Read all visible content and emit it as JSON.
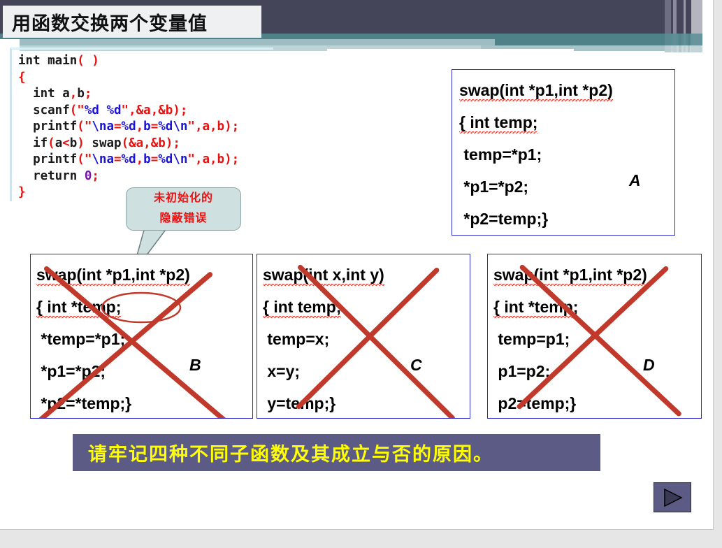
{
  "slide": {
    "title": "用函数交换两个变量值",
    "banner_text": "请牢记四种不同子函数及其成立与否的原因。",
    "next_label": "play-triangle"
  },
  "theme": {
    "band_dark": "#454559",
    "band_teal": "#4f8288",
    "band_light_blue": "#a8c3c8",
    "box_border": "#2a2ad0",
    "mark_red": "#c0392b",
    "banner_bg": "#5b5b86",
    "banner_fg": "#ffff00",
    "callout_bg": "#cfe0e0",
    "callout_fg": "#ee1111",
    "code_punct": "#e8110f",
    "code_blue": "#1b13d8",
    "code_purple": "#7711aa"
  },
  "code": {
    "lines": [
      "int main( )",
      "{",
      "  int a,b;",
      "  scanf(\"%d %d\",&a,&b);",
      "  printf(\"\\na=%d,b=%d\\n\",a,b);",
      "  if(a<b) swap(&a,&b);",
      "  printf(\"\\na=%d,b=%d\\n\",a,b);",
      "  return 0;",
      "}"
    ]
  },
  "callout": {
    "line1": "未初始化的",
    "line2": "隐蔽错误"
  },
  "answers": [
    {
      "tag": "A",
      "correct": true,
      "lines": [
        "swap(int *p1,int *p2)",
        "{ int temp;",
        " temp=*p1;",
        " *p1=*p2;",
        " *p2=temp;}"
      ]
    },
    {
      "tag": "B",
      "correct": false,
      "lines": [
        "swap(int *p1,int *p2)",
        "{ int *temp;",
        " *temp=*p1;",
        " *p1=*p2;",
        " *p2=*temp;}"
      ]
    },
    {
      "tag": "C",
      "correct": false,
      "lines": [
        "swap(int x,int y)",
        "{ int temp;",
        " temp=x;",
        " x=y;",
        " y=temp;}"
      ]
    },
    {
      "tag": "D",
      "correct": false,
      "lines": [
        "swap(int *p1,int *p2)",
        "{ int *temp;",
        " temp=p1;",
        " p1=p2;",
        " p2=temp;}"
      ]
    }
  ]
}
